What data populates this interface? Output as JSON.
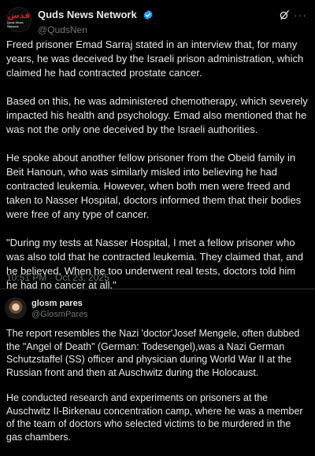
{
  "post": {
    "author": {
      "display_name": "Quds News Network",
      "handle": "@QudsNen",
      "avatar_text_ar": "قدس",
      "avatar_text_en": "Quds News Network"
    },
    "paragraphs": [
      "Freed prisoner Emad Sarraj stated in an interview that, for many years, he was deceived by the Israeli prison administration, which claimed he had contracted prostate cancer.",
      "Based on this, he was administered chemotherapy, which severely impacted his health and psychology. Emad also mentioned that he was not the only one deceived by the Israeli authorities.",
      "He spoke about another fellow prisoner from the Obeid family in Beit Hanoun, who was similarly misled into believing he had contracted leukemia. However, when both men were freed and taken to Nasser Hospital, doctors informed them that their bodies were free of any type of cancer.",
      "\"During my tests at Nasser Hospital, I met a fellow prisoner who was also told that he contracted leukemia. They claimed that, and he believed. When he too underwent real tests, doctors told him he had no cancer at all.\""
    ],
    "timestamp": "10:51 PM · Oct 23, 2025"
  },
  "reply": {
    "author": {
      "display_name": "glosm pares",
      "handle": "@GlosmPares"
    },
    "paragraphs": [
      "The report resembles the Nazi 'doctor'Josef Mengele, often dubbed the \"Angel of Death\" (German: Todesengel),was a Nazi German Schutzstaffel (SS) officer and physician during World War II at the Russian front and then at Auschwitz during the Holocaust.",
      "He conducted research and experiments on prisoners at the Auschwitz II-Birkenau concentration camp, where he was a member of the team of doctors who selected victims to be murdered in the gas chambers."
    ]
  },
  "icons": {
    "verified": "verified-badge-icon",
    "grok": "grok-icon",
    "more": "more-options-icon"
  },
  "colors": {
    "background": "#000000",
    "text": "#e7e9ea",
    "secondary_text": "#71767b",
    "verified_blue": "#1d9bf0",
    "divider": "#2f3336",
    "brand_red": "#d11f1f"
  }
}
